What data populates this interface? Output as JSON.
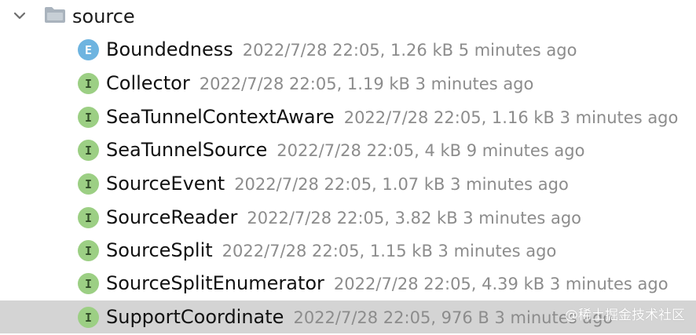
{
  "folder": {
    "label": "source",
    "icon": "folder-icon",
    "expanded": true
  },
  "items": [
    {
      "kind": "E",
      "kind_name": "enum",
      "name": "Boundedness",
      "meta": "2022/7/28 22:05, 1.26 kB 5 minutes ago"
    },
    {
      "kind": "I",
      "kind_name": "interface",
      "name": "Collector",
      "meta": "2022/7/28 22:05, 1.19 kB 3 minutes ago"
    },
    {
      "kind": "I",
      "kind_name": "interface",
      "name": "SeaTunnelContextAware",
      "meta": "2022/7/28 22:05, 1.16 kB 3 minutes ago"
    },
    {
      "kind": "I",
      "kind_name": "interface",
      "name": "SeaTunnelSource",
      "meta": "2022/7/28 22:05, 4 kB 9 minutes ago"
    },
    {
      "kind": "I",
      "kind_name": "interface",
      "name": "SourceEvent",
      "meta": "2022/7/28 22:05, 1.07 kB 3 minutes ago"
    },
    {
      "kind": "I",
      "kind_name": "interface",
      "name": "SourceReader",
      "meta": "2022/7/28 22:05, 3.82 kB 3 minutes ago"
    },
    {
      "kind": "I",
      "kind_name": "interface",
      "name": "SourceSplit",
      "meta": "2022/7/28 22:05, 1.15 kB 3 minutes ago"
    },
    {
      "kind": "I",
      "kind_name": "interface",
      "name": "SourceSplitEnumerator",
      "meta": "2022/7/28 22:05, 4.39 kB 3 minutes ago"
    },
    {
      "kind": "I",
      "kind_name": "interface",
      "name": "SupportCoordinate",
      "meta": "2022/7/28 22:05, 976 B 3 minutes ago",
      "selected": true
    }
  ],
  "watermark": "@稀土掘金技术社区",
  "colors": {
    "selection": "#d4d4d4",
    "interface_icon": "#9ccf84",
    "enum_icon": "#6eb4e0",
    "meta_text": "#8c8c8c"
  }
}
